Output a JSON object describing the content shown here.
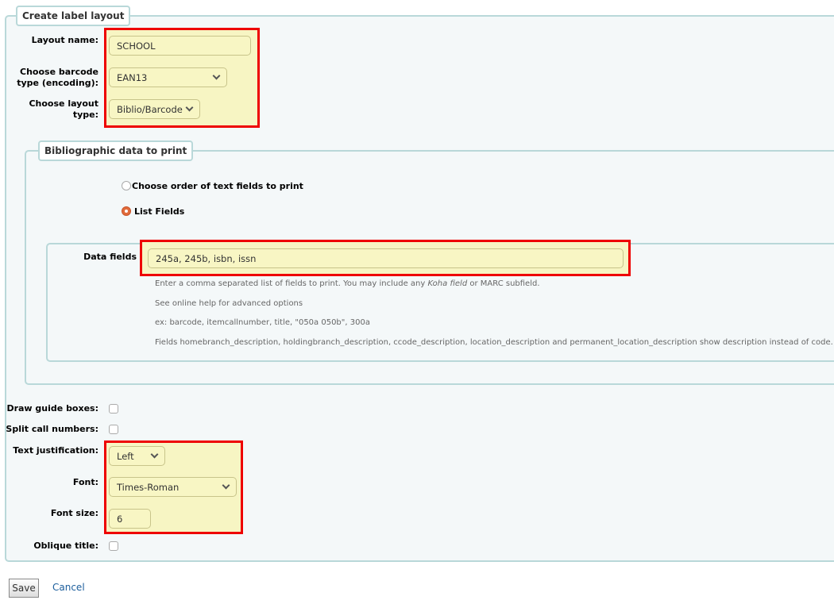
{
  "legend": "Create label layout",
  "layout_name": {
    "label": "Layout name:",
    "value": "SCHOOL"
  },
  "barcode_type": {
    "label": "Choose barcode type (encoding):",
    "value": "EAN13"
  },
  "layout_type": {
    "label": "Choose layout type:",
    "value": "Biblio/Barcode"
  },
  "biblio": {
    "legend": "Bibliographic data to print",
    "radio_order": "Choose order of text fields to print",
    "radio_list": "List Fields",
    "selected": "List Fields",
    "data_fields": {
      "label": "Data fields",
      "value": "245a, 245b, isbn, issn",
      "help1_pre": "Enter a comma separated list of fields to print. You may include any ",
      "help1_em": "Koha field",
      "help1_post": " or MARC subfield.",
      "help2": "See online help for advanced options",
      "help3": "ex: barcode, itemcallnumber, title, \"050a 050b\", 300a",
      "help4": "Fields homebranch_description, holdingbranch_description, ccode_description, location_description and permanent_location_description show description instead of code."
    }
  },
  "guide_boxes": {
    "label": "Draw guide boxes:",
    "checked": false
  },
  "split_call": {
    "label": "Split call numbers:",
    "checked": false
  },
  "justification": {
    "label": "Text justification:",
    "value": "Left"
  },
  "font": {
    "label": "Font:",
    "value": "Times-Roman"
  },
  "font_size": {
    "label": "Font size:",
    "value": "6"
  },
  "oblique": {
    "label": "Oblique title:",
    "checked": false
  },
  "save": "Save",
  "cancel": "Cancel"
}
